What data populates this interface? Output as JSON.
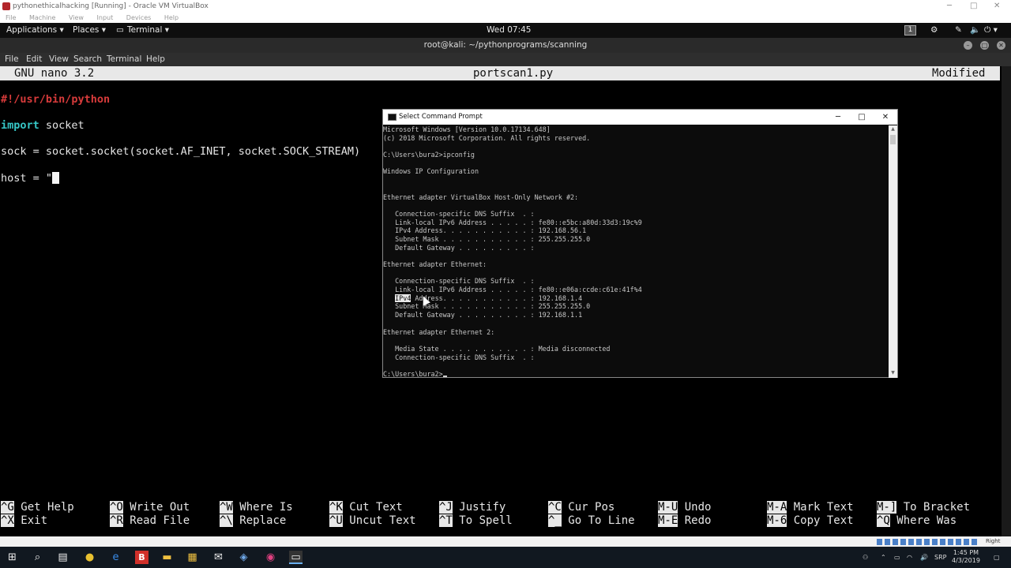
{
  "vbox": {
    "title": "pythonethicalhacking [Running] - Oracle VM VirtualBox",
    "menu": [
      "File",
      "Machine",
      "View",
      "Input",
      "Devices",
      "Help"
    ],
    "status_right": "Right Ctrl"
  },
  "kali_panel": {
    "applications": "Applications ▾",
    "places": "Places ▾",
    "terminal": "Terminal ▾",
    "clock": "Wed 07:45",
    "workspace": "1"
  },
  "terminal": {
    "title": "root@kali: ~/pythonprograms/scanning",
    "menu": [
      "File",
      "Edit",
      "View",
      "Search",
      "Terminal",
      "Help"
    ]
  },
  "nano": {
    "version": "GNU nano 3.2",
    "filename": "portscan1.py",
    "state": "Modified",
    "code": {
      "shebang": "#!/usr/bin/python",
      "import_kw": "import",
      "import_rest": " socket",
      "line_sock": "sock = socket.socket(socket.AF_INET, socket.SOCK_STREAM)",
      "line_host": "host = \""
    },
    "shortcuts": [
      {
        "k1": "^G",
        "l1": "Get Help",
        "k2": "^X",
        "l2": "Exit"
      },
      {
        "k1": "^O",
        "l1": "Write Out",
        "k2": "^R",
        "l2": "Read File"
      },
      {
        "k1": "^W",
        "l1": "Where Is",
        "k2": "^\\",
        "l2": "Replace"
      },
      {
        "k1": "^K",
        "l1": "Cut Text",
        "k2": "^U",
        "l2": "Uncut Text"
      },
      {
        "k1": "^J",
        "l1": "Justify",
        "k2": "^T",
        "l2": "To Spell"
      },
      {
        "k1": "^C",
        "l1": "Cur Pos",
        "k2": "^_",
        "l2": "Go To Line"
      },
      {
        "k1": "M-U",
        "l1": "Undo",
        "k2": "M-E",
        "l2": "Redo"
      },
      {
        "k1": "M-A",
        "l1": "Mark Text",
        "k2": "M-6",
        "l2": "Copy Text"
      },
      {
        "k1": "M-]",
        "l1": "To Bracket",
        "k2": "^Q",
        "l2": "Where Was"
      }
    ]
  },
  "cmd": {
    "title": "Select Command Prompt",
    "lines": [
      "Microsoft Windows [Version 10.0.17134.648]",
      "(c) 2018 Microsoft Corporation. All rights reserved.",
      "",
      "C:\\Users\\bura2>ipconfig",
      "",
      "Windows IP Configuration",
      "",
      "",
      "Ethernet adapter VirtualBox Host-Only Network #2:",
      "",
      "   Connection-specific DNS Suffix  . :",
      "   Link-local IPv6 Address . . . . . : fe80::e5bc:a80d:33d3:19c%9",
      "   IPv4 Address. . . . . . . . . . . : 192.168.56.1",
      "   Subnet Mask . . . . . . . . . . . : 255.255.255.0",
      "   Default Gateway . . . . . . . . . :",
      "",
      "Ethernet adapter Ethernet:",
      "",
      "   Connection-specific DNS Suffix  . :",
      "   Link-local IPv6 Address . . . . . : fe80::e06a:ccde:c61e:41f%4",
      "",
      "   Subnet Mask . . . . . . . . . . . : 255.255.255.0",
      "   Default Gateway . . . . . . . . . : 192.168.1.1",
      "",
      "Ethernet adapter Ethernet 2:",
      "",
      "   Media State . . . . . . . . . . . : Media disconnected",
      "   Connection-specific DNS Suffix  . :",
      "",
      "C:\\Users\\bura2>"
    ],
    "ipv4_selected": "IPv4",
    "ipv4_rest": " Address. . . . . . . . . . . : 192.168.1.4"
  },
  "taskbar": {
    "lang": "SRP",
    "time": "1:45 PM",
    "date": "4/3/2019"
  },
  "icons": {
    "start": "windows-start-icon",
    "search": "search-icon",
    "taskview": "task-view-icon",
    "chrome": "chrome-icon",
    "edge": "edge-icon",
    "burp": "burp-icon",
    "explorer": "file-explorer-icon",
    "store": "store-icon",
    "mail": "mail-icon",
    "vbox": "virtualbox-icon",
    "app": "app-icon",
    "cmd": "command-prompt-icon"
  }
}
